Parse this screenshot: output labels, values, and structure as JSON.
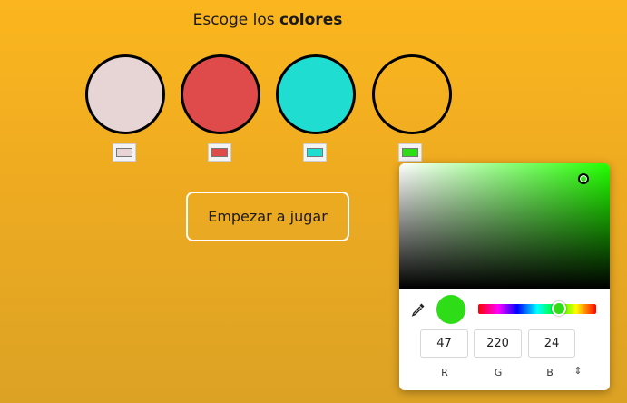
{
  "header": {
    "title_prefix": "Escoge los",
    "title_bold": "colores"
  },
  "colors": {
    "circle1": "#e7d4d5",
    "circle2": "#df4a4b",
    "circle3": "#1fddd1",
    "circle4": "transparent",
    "picked": "#2fdc18"
  },
  "start_button": {
    "label": "Empezar a jugar"
  },
  "picker": {
    "r": "47",
    "g": "220",
    "b": "24",
    "r_label": "R",
    "g_label": "G",
    "b_label": "B",
    "toggle_icon": "⌃⌄"
  }
}
